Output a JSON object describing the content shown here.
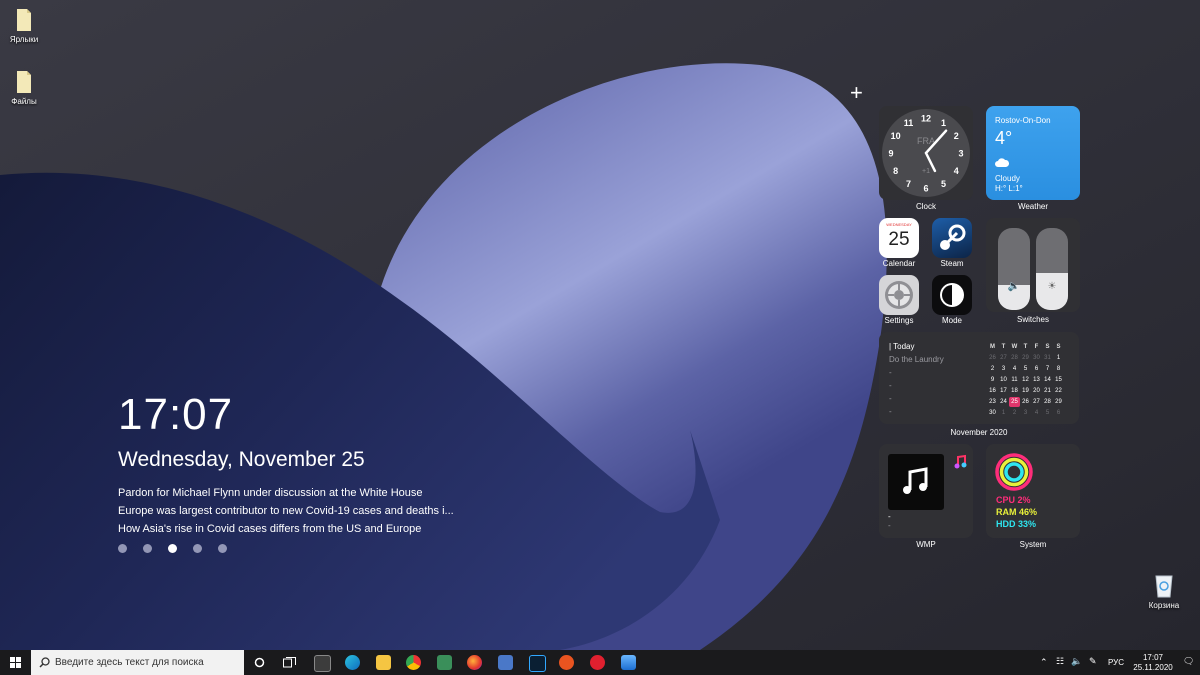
{
  "desktop": {
    "icons": [
      {
        "label": "Ярлыки"
      },
      {
        "label": "Файлы"
      },
      {
        "label": "Корзина"
      }
    ]
  },
  "lock_screen": {
    "time": "17:07",
    "date": "Wednesday, November 25",
    "news": [
      "Pardon for Michael Flynn under discussion at the White House",
      "Europe was largest contributor to new Covid-19 cases and deaths i...",
      "How Asia's rise in Covid cases differs from the US and Europe"
    ],
    "page_count": 5,
    "active_page": 3
  },
  "widgets": {
    "add_icon": "+",
    "clock": {
      "label": "Clock",
      "day": "FRA",
      "offset": "+1",
      "numerals": [
        "12",
        "1",
        "2",
        "3",
        "4",
        "5",
        "6",
        "7",
        "8",
        "9",
        "10",
        "11"
      ],
      "hour": 5,
      "minute": 7
    },
    "weather": {
      "label": "Weather",
      "city": "Rostov-On-Don",
      "temp": "4°",
      "condition": "Cloudy",
      "hilo": "H:° L:1°",
      "icon": "cloud-icon"
    },
    "calendar_app": {
      "label": "Calendar",
      "weekday": "WEDNESDAY",
      "day": "25"
    },
    "steam_app": {
      "label": "Steam"
    },
    "settings_app": {
      "label": "Settings"
    },
    "mode_app": {
      "label": "Mode"
    },
    "switches": {
      "label": "Switches",
      "volume_level": 0.3,
      "brightness_level": 0.45
    },
    "month_calendar": {
      "label": "November 2020",
      "today_title": "| Today",
      "task": "Do the Laundry",
      "dashes": [
        "-",
        "-",
        "-",
        "-"
      ],
      "weekdays": [
        "M",
        "T",
        "W",
        "T",
        "F",
        "S",
        "S"
      ],
      "weeks": [
        [
          "26",
          "27",
          "28",
          "29",
          "30",
          "31",
          "1"
        ],
        [
          "2",
          "3",
          "4",
          "5",
          "6",
          "7",
          "8"
        ],
        [
          "9",
          "10",
          "11",
          "12",
          "13",
          "14",
          "15"
        ],
        [
          "16",
          "17",
          "18",
          "19",
          "20",
          "21",
          "22"
        ],
        [
          "23",
          "24",
          "25",
          "26",
          "27",
          "28",
          "29"
        ],
        [
          "30",
          "1",
          "2",
          "3",
          "4",
          "5",
          "6"
        ]
      ],
      "selected": "25"
    },
    "wmp": {
      "label": "WMP",
      "track_lines": [
        "-",
        "-"
      ]
    },
    "system": {
      "label": "System",
      "cpu": "CPU 2%",
      "ram": "RAM 46%",
      "hdd": "HDD 33%",
      "cpu_color": "#ff2d7a",
      "ram_color": "#e8f03a",
      "hdd_color": "#2ee6f0"
    }
  },
  "taskbar": {
    "search_placeholder": "Введите здесь текст для поиска",
    "lang": "РУС",
    "time": "17:07",
    "date": "25.11.2020"
  }
}
